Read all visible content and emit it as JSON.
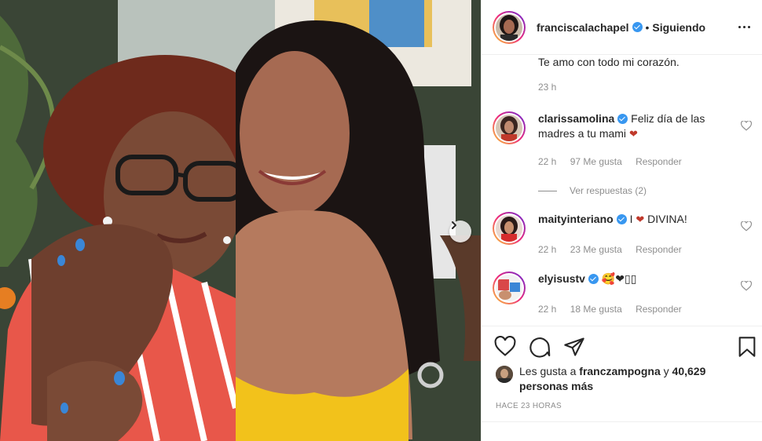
{
  "post_header": {
    "username": "franciscalachapel",
    "separator": "•",
    "follow_state": "Siguiendo"
  },
  "caption": {
    "text": "Te amo con todo mi corazón.",
    "time": "23 h"
  },
  "comments": [
    {
      "username": "clarissamolina",
      "text": "Feliz día de las madres a tu mami",
      "emoji": "❤",
      "time": "22 h",
      "likes": "97 Me gusta",
      "reply": "Responder"
    },
    {
      "username": "maityinteriano",
      "text_before": "I",
      "emoji": "❤",
      "text_after": "DIVINA!",
      "time": "22 h",
      "likes": "23 Me gusta",
      "reply": "Responder"
    },
    {
      "username": "elyisustv",
      "text": "🥰❤▯▯",
      "time": "22 h",
      "likes": "18 Me gusta",
      "reply": "Responder"
    }
  ],
  "view_replies": "Ver respuestas (2)",
  "likes_summary": {
    "prefix": "Les gusta a",
    "user": "franczampogna",
    "suffix": "y",
    "others": "40,629 personas más"
  },
  "posted_ago": "HACE 23 HORAS",
  "colors": {
    "verified": "#3897f0",
    "secondary_text": "#8e8e8e",
    "primary_text": "#262626",
    "heart_red": "#c0392b"
  },
  "icons": {
    "like": "heart-outline-icon",
    "comment": "speech-bubble-icon",
    "share": "paper-plane-icon",
    "save": "bookmark-icon",
    "more": "ellipsis-icon",
    "next": "chevron-right-icon"
  }
}
